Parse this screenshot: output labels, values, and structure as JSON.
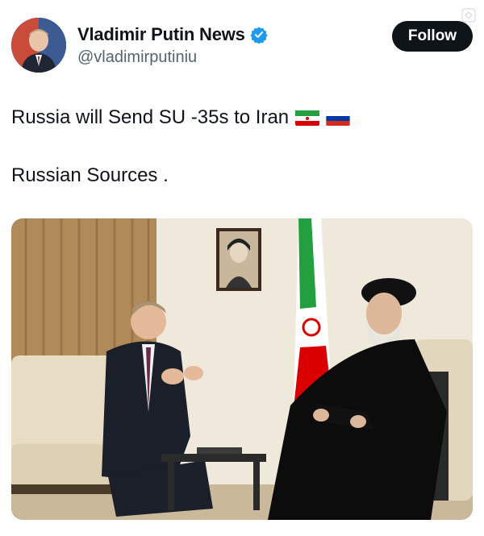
{
  "author": {
    "display_name": "Vladimir Putin News",
    "handle": "@vladimirputiniu",
    "verified_icon": "verified-badge-icon",
    "verified_color": "#1d9bf0"
  },
  "actions": {
    "follow_label": "Follow"
  },
  "tweet": {
    "line1": "Russia will Send SU -35s to Iran",
    "line2": "Russian Sources .",
    "flags": [
      "iran-flag-icon",
      "russia-flag-icon"
    ]
  },
  "media": {
    "description_icon": "photo-leaders-meeting"
  },
  "colors": {
    "text": "#0f1419",
    "secondary": "#536471",
    "button": "#0f1419"
  }
}
